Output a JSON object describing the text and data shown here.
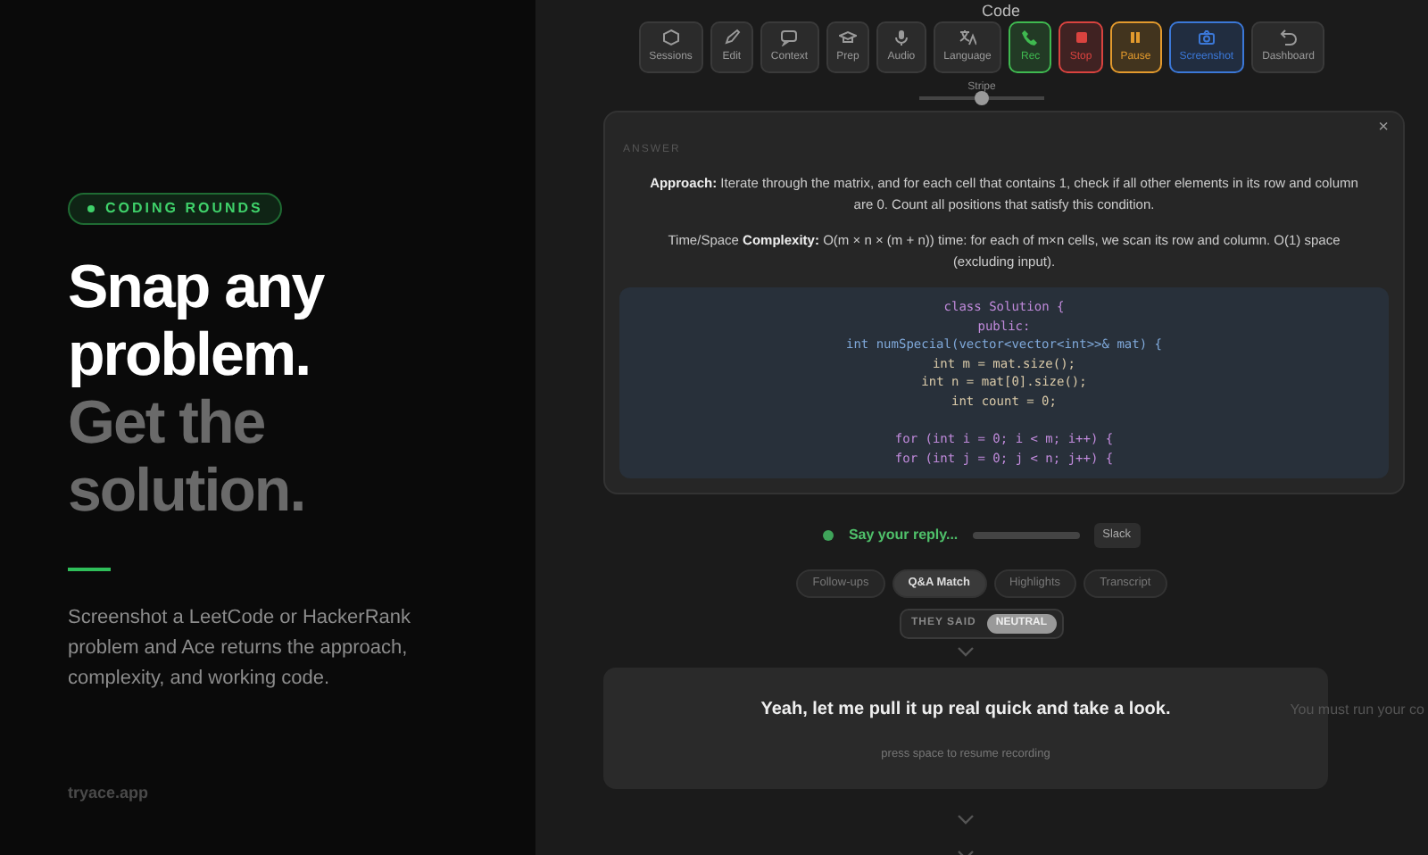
{
  "hero": {
    "tag": "CODING ROUNDS",
    "headline_lines": [
      {
        "text": "Snap any",
        "kind": "primary"
      },
      {
        "text": "problem.",
        "kind": "primary"
      },
      {
        "text": "Get the",
        "kind": "muted"
      },
      {
        "text": "solution.",
        "kind": "muted"
      }
    ],
    "description": "Screenshot a LeetCode or HackerRank problem and Ace returns the approach, complexity, and working code.",
    "footer": "tryace.app"
  },
  "app": {
    "code_title": "Code",
    "toolbar": [
      {
        "label": "Sessions"
      },
      {
        "label": "Edit"
      },
      {
        "label": "Context"
      },
      {
        "label": "Prep"
      },
      {
        "label": "Audio"
      },
      {
        "label": "Language"
      },
      {
        "label": "Rec",
        "color": "#3fb950"
      },
      {
        "label": "Stop",
        "color": "#d9433f"
      },
      {
        "label": "Pause",
        "color": "#e39a2d"
      },
      {
        "label": "Screenshot",
        "color": "#3b78d8"
      },
      {
        "label": "Dashboard"
      }
    ],
    "slider": {
      "label": "Stripe",
      "level": 0.5
    },
    "answer": {
      "title": "ANSWER",
      "close": "×",
      "paragraphs": [
        "**Approach:** Iterate through the matrix, and for each cell that contains 1, check if all other elements in its row and column are 0. Count all positions that satisfy this condition.",
        "Time/Space **Complexity:** O(m × n × (m + n)) time: for each of m×n cells, we scan its row and column. O(1) space (excluding input)."
      ],
      "code": [
        {
          "text": "class Solution {",
          "kind": "keyword"
        },
        {
          "text": "public:",
          "kind": "keyword"
        },
        {
          "text": "int numSpecial(vector<vector<int>>& mat) {",
          "kind": "function"
        },
        {
          "text": "int m = mat.size();",
          "kind": "plain"
        },
        {
          "text": "int n = mat[0].size();",
          "kind": "plain"
        },
        {
          "text": "int count = 0;",
          "kind": "plain"
        },
        {
          "text": "for (int i = 0; i < m; i++) {",
          "kind": "keyword",
          "blank_before": true
        },
        {
          "text": "for (int j = 0; j < n; j++) {",
          "kind": "keyword"
        }
      ]
    },
    "reply": {
      "prompt": "Say your reply...",
      "tag": "Slack"
    },
    "tabs": [
      {
        "label": "Follow-ups",
        "selected": false
      },
      {
        "label": "Q&A Match",
        "selected": true
      },
      {
        "label": "Highlights",
        "selected": false
      },
      {
        "label": "Transcript",
        "selected": false
      }
    ],
    "they_said": {
      "label": "THEY SAID",
      "sentiment": "NEUTRAL"
    },
    "quote": {
      "text": "Yeah, let me pull it up real quick and take a look.",
      "hint": "press space to resume recording"
    },
    "side_note": "You must run your co"
  }
}
